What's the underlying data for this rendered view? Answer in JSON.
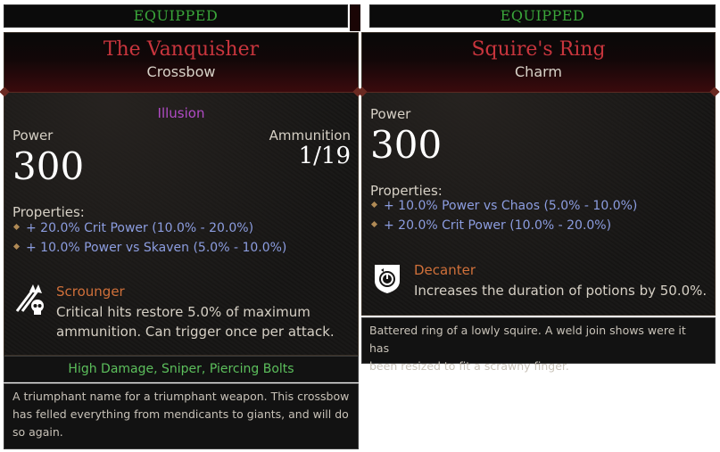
{
  "left": {
    "equipped": "EQUIPPED",
    "title": "The Vanquisher",
    "subtitle": "Crossbow",
    "tag": "Illusion",
    "stat_label": "Power",
    "stat_value": "300",
    "ammo_label": "Ammunition",
    "ammo_value": "1/19",
    "properties_label": "Properties:",
    "properties": [
      "+ 20.0% Crit Power (10.0% - 20.0%)",
      "+ 10.0% Power vs Skaven (5.0% - 10.0%)"
    ],
    "trait": {
      "icon": "scrounger-icon",
      "name": "Scrounger",
      "line1": "Critical hits restore 5.0% of maximum",
      "line2": "ammunition. Can trigger once per attack."
    },
    "keywords": "High Damage, Sniper, Piercing Bolts",
    "flavor": [
      "A triumphant name for a triumphant weapon. This crossbow",
      "has felled everything from mendicants to giants, and will do",
      "so again."
    ]
  },
  "right": {
    "equipped": "EQUIPPED",
    "title": "Squire's Ring",
    "subtitle": "Charm",
    "stat_label": "Power",
    "stat_value": "300",
    "properties_label": "Properties:",
    "properties": [
      "+ 10.0% Power vs Chaos (5.0% - 10.0%)",
      "+ 20.0% Crit Power (10.0% - 20.0%)"
    ],
    "trait": {
      "icon": "decanter-icon",
      "name": "Decanter",
      "line1": "Increases the duration of potions by 50.0%."
    },
    "flavor": [
      "Battered ring of a lowly squire. A weld join shows were it has",
      "been resized to fit a scrawny finger."
    ]
  },
  "colors": {
    "equipped": "#3aa63a",
    "title": "#c8353d",
    "property": "#8c9de0",
    "trait_name": "#d0703a",
    "tag": "#b04bc4",
    "keywords": "#5cbf5c"
  }
}
